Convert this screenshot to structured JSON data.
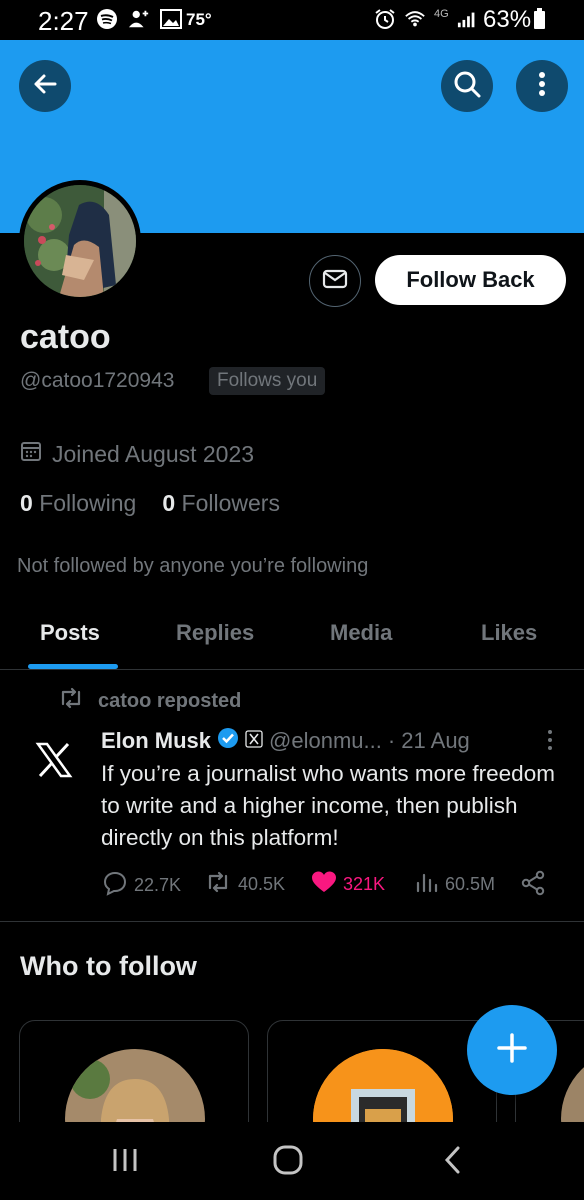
{
  "status_bar": {
    "time": "2:27",
    "temperature": "75°",
    "network": "4G",
    "battery": "63%",
    "icons_left": [
      "spotify-icon",
      "add-person-icon",
      "image-icon"
    ],
    "icons_right": [
      "alarm-icon",
      "wifi-icon",
      "signal-icon",
      "battery-icon"
    ]
  },
  "header": {
    "banner_color": "#1d9bf0",
    "back_icon": "arrow-left-icon",
    "search_icon": "search-icon",
    "more_icon": "more-vertical-icon"
  },
  "profile": {
    "name": "catoo",
    "handle": "@catoo1720943",
    "follows_you": "Follows you",
    "joined": "Joined August 2023",
    "following_count": "0",
    "following_label": "Following",
    "followers_count": "0",
    "followers_label": "Followers",
    "mutuals_note": "Not followed by anyone you’re following",
    "follow_back_label": "Follow Back",
    "message_icon": "envelope-icon"
  },
  "tabs": [
    {
      "label": "Posts",
      "active": true
    },
    {
      "label": "Replies",
      "active": false
    },
    {
      "label": "Media",
      "active": false
    },
    {
      "label": "Likes",
      "active": false
    }
  ],
  "post": {
    "repost_label": "catoo reposted",
    "author_name": "Elon Musk",
    "author_handle": "@elonmu...",
    "date": "· 21 Aug",
    "text": "If you’re a journalist who wants more freedom to write and a higher income, then publish directly on this platform!",
    "replies": "22.7K",
    "reposts": "40.5K",
    "likes": "321K",
    "views": "60.5M",
    "like_color": "#f91880"
  },
  "who_to_follow": {
    "title": "Who to follow"
  },
  "fab_icon": "plus-icon",
  "nav_bar": {
    "icons": [
      "recents-icon",
      "home-icon",
      "back-icon"
    ]
  }
}
